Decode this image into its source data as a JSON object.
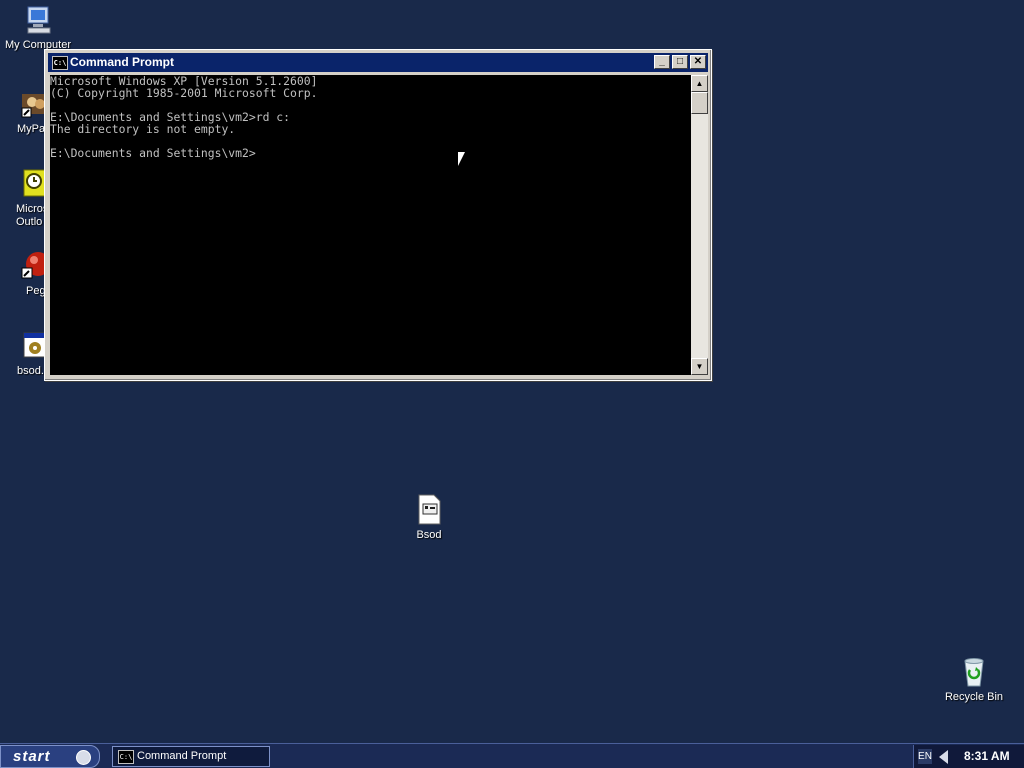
{
  "desktop": {
    "icons": [
      {
        "label": "My Computer",
        "icon": "my-computer-icon"
      },
      {
        "label": "MyPa",
        "icon": "my-pictures-shortcut-icon"
      },
      {
        "label": "Micros Outlo",
        "icon": "outlook-icon"
      },
      {
        "label": "Peg",
        "icon": "peg-shortcut-icon"
      },
      {
        "label": "bsod.",
        "icon": "bsod-program-icon"
      },
      {
        "label": "Bsod",
        "icon": "bsod-file-icon"
      },
      {
        "label": "Recycle Bin",
        "icon": "recycle-bin-icon"
      }
    ],
    "background_color": "#19294a"
  },
  "window": {
    "title": "Command Prompt",
    "icon_text": "C:\\",
    "buttons": {
      "minimize": "_",
      "maximize": "□",
      "close": "✕"
    },
    "console_lines": [
      "Microsoft Windows XP [Version 5.1.2600]",
      "(C) Copyright 1985-2001 Microsoft Corp.",
      "",
      "E:\\Documents and Settings\\vm2>rd c:",
      "The directory is not empty.",
      "",
      "E:\\Documents and Settings\\vm2>"
    ],
    "scroll_up": "▲",
    "scroll_down": "▼"
  },
  "taskbar": {
    "start_label": "start",
    "tasks": [
      {
        "label": "Command Prompt",
        "icon_text": "C:\\"
      }
    ],
    "language": "EN",
    "clock": "8:31 AM"
  }
}
